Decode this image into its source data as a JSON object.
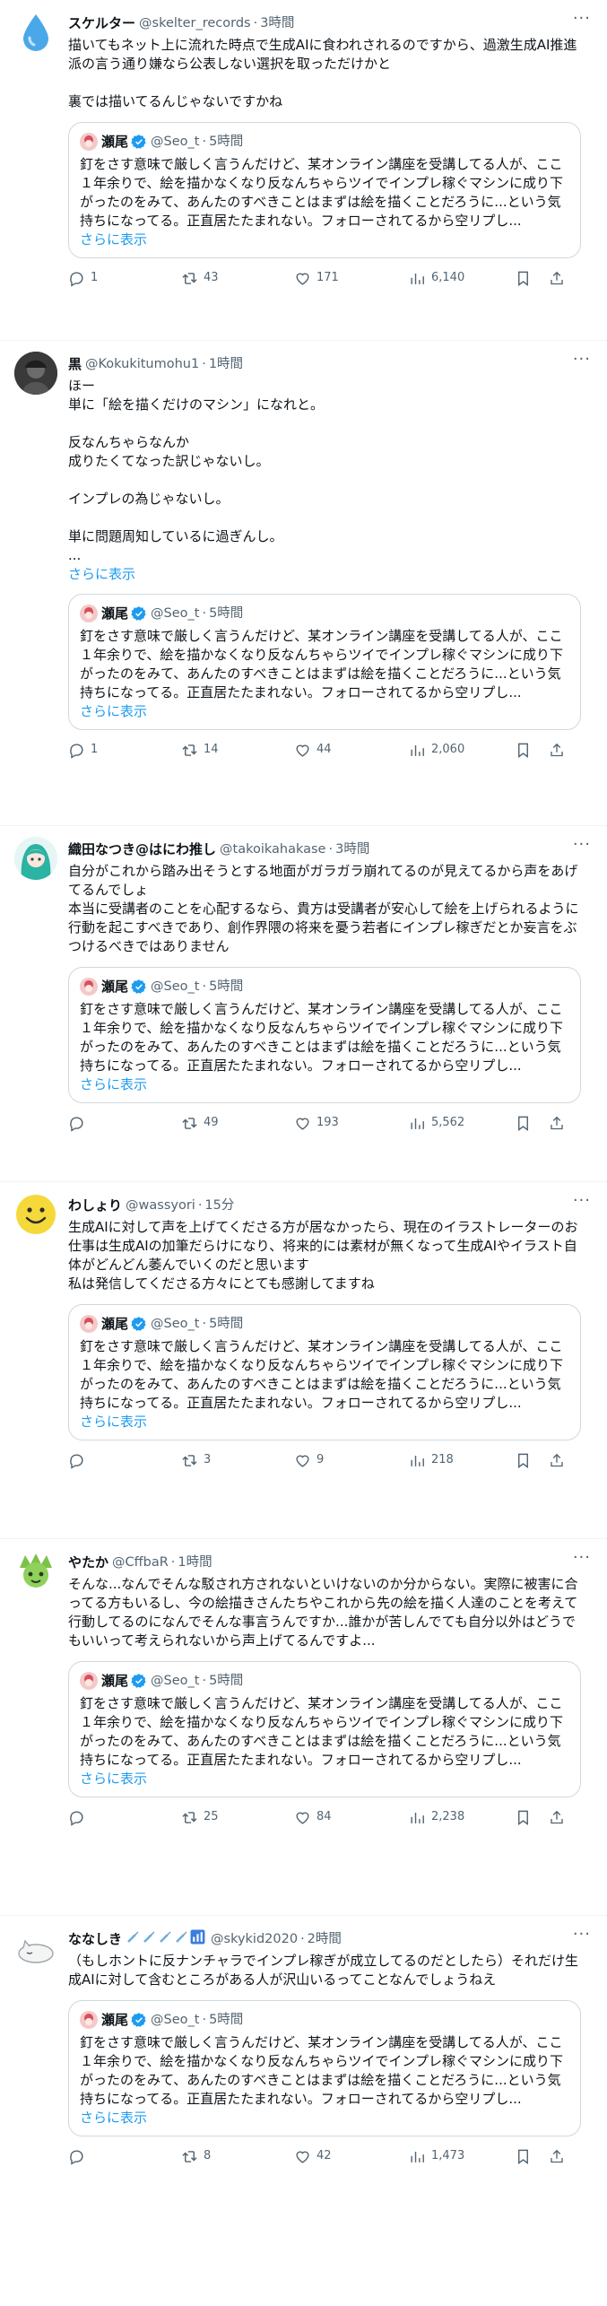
{
  "ui": {
    "show_more": "さらに表示",
    "more_glyph": "···"
  },
  "quoted": {
    "name": "瀬尾",
    "handle": "@Seo_t",
    "time": "5時間",
    "text": "釘をさす意味で厳しく言うんだけど、某オンライン講座を受講してる人が、ここ１年余りで、絵を描かなくなり反なんちゃらツイでインプレ稼ぐマシンに成り下がったのをみて、あんたのすべきことはまずは絵を描くことだろうに...という気持ちになってる。正直居たたまれない。フォローされてるから空リプし..."
  },
  "tweets": [
    {
      "name": "スケルター",
      "handle": "@skelter_records",
      "time": "3時間",
      "avatar_icon": "water-drop-icon",
      "text": "描いてもネット上に流れた時点で生成AIに食われされるのですから、過激生成AI推進派の言う通り嫌なら公表しない選択を取っただけかと\n\n裏では描いてるんじゃないですかね",
      "show_more": false,
      "replies": "1",
      "retweets": "43",
      "likes": "171",
      "views": "6,140"
    },
    {
      "name": "黒",
      "handle": "@Kokukitumohu1",
      "time": "1時間",
      "avatar_icon": "dark-portrait-avatar",
      "text": "ほー\n単に「絵を描くだけのマシン」になれと。\n\n反なんちゃらなんか\n成りたくてなった訳じゃないし。\n\nインプレの為じゃないし。\n\n単に問題周知しているに過ぎんし。\n...",
      "show_more": true,
      "replies": "1",
      "retweets": "14",
      "likes": "44",
      "views": "2,060"
    },
    {
      "name": "織田なつき@はにわ推し",
      "handle": "@takoikahakase",
      "time": "3時間",
      "avatar_icon": "anime-girl-avatar",
      "text": "自分がこれから踏み出そうとする地面がガラガラ崩れてるのが見えてるから声をあげてるんでしょ\n本当に受講者のことを心配するなら、貴方は受講者が安心して絵を上げられるように行動を起こすべきであり、創作界隈の将来を憂う若者にインプレ稼ぎだとか妄言をぶつけるべきではありません",
      "show_more": false,
      "replies": "",
      "retweets": "49",
      "likes": "193",
      "views": "5,562"
    },
    {
      "name": "わしょり",
      "handle": "@wassyori",
      "time": "15分",
      "avatar_icon": "smiley-face-icon",
      "text": "生成AIに対して声を上げてくださる方が居なかったら、現在のイラストレーターのお仕事は生成AIの加筆だらけになり、将来的には素材が無くなって生成AIやイラスト自体がどんどん萎んでいくのだと思います\n私は発信してくださる方々にとても感謝してますね",
      "show_more": false,
      "replies": "",
      "retweets": "3",
      "likes": "9",
      "views": "218"
    },
    {
      "name": "やたか",
      "handle": "@CffbaR",
      "time": "1時間",
      "avatar_icon": "green-character-avatar",
      "text": "そんな...なんでそんな駁され方されないといけないのか分からない。実際に被害に合ってる方もいるし、今の絵描きさんたちやこれから先の絵を描く人達のことを考えて行動してるのになんでそんな事言うんですか...誰かが苦しんでても自分以外はどうでもいいって考えられないから声上げてるんですよ...",
      "show_more": false,
      "replies": "",
      "retweets": "25",
      "likes": "84",
      "views": "2,238"
    },
    {
      "name": "ななしき",
      "handle": "@skykid2020",
      "time": "2時間",
      "avatar_icon": "sleeping-cat-avatar",
      "text": "（もしホントに反ナンチャラでインプレ稼ぎが成立してるのだとしたら）それだけ生成AIに対して含むところがある人が沢山いるってことなんでしょうねえ",
      "show_more": false,
      "replies": "",
      "retweets": "8",
      "likes": "42",
      "views": "1,473"
    }
  ]
}
